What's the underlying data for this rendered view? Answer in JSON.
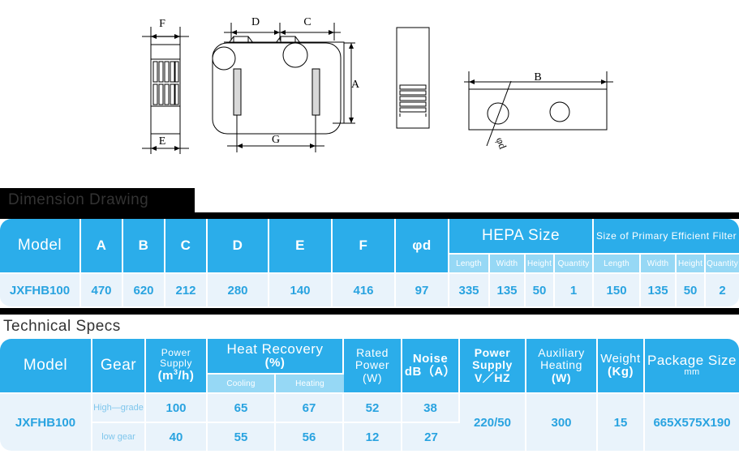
{
  "drawing": {
    "labels": {
      "f": "F",
      "e": "E",
      "d": "D",
      "c": "C",
      "g": "G",
      "a": "A",
      "b": "B",
      "phid": "φd"
    }
  },
  "sections": {
    "dimension_banner": "Dimension Drawing",
    "technical_banner": "Technical  Specs"
  },
  "dimension_table": {
    "headers": {
      "model": "Model",
      "a": "A",
      "b": "B",
      "c": "C",
      "d": "D",
      "e": "E",
      "f": "F",
      "phid": "φd",
      "hepa_size": "HEPA  Size",
      "primary_filter": "Size of Primary Efficient Filter"
    },
    "subheaders": {
      "hepa_length": "Length",
      "hepa_width": "Width",
      "hepa_height": "Height",
      "hepa_quantity": "Quantity",
      "pf_length": "Length",
      "pf_width": "Width",
      "pf_height": "Height",
      "pf_quantity": "Quantity"
    },
    "row": {
      "model": "JXFHB100",
      "a": "470",
      "b": "620",
      "c": "212",
      "d": "280",
      "e": "140",
      "f": "416",
      "phid": "97",
      "hepa_length": "335",
      "hepa_width": "135",
      "hepa_height": "50",
      "hepa_quantity": "1",
      "pf_length": "150",
      "pf_width": "135",
      "pf_height": "50",
      "pf_quantity": "2"
    }
  },
  "technical_table": {
    "headers": {
      "model": "Model",
      "gear": "Gear",
      "power_supply_line1": "Power",
      "power_supply_line2": "Supply",
      "power_supply_line3": "(m",
      "power_supply_sup": "3",
      "power_supply_line3b": "/h)",
      "heat_recovery_line1": "Heat  Recovery",
      "heat_recovery_line2": "(%)",
      "rated_power_line1": "Rated",
      "rated_power_line2": "Power",
      "rated_power_line3": "(W)",
      "noise_line1": "Noise",
      "noise_line2": "dB（A）",
      "power_supply_v_line1": "Power",
      "power_supply_v_line2": "Supply",
      "power_supply_v_line3": "V／HZ",
      "aux_heating_line1": "Auxiliary",
      "aux_heating_line2": "Heating",
      "aux_heating_line3": "(W)",
      "weight_line1": "Weight",
      "weight_line2": "(Kg)",
      "package_size_line1": "Package  Size",
      "package_size_line2": "mm"
    },
    "subheaders": {
      "cooling": "Cooling",
      "heating": "Heating"
    },
    "row": {
      "model": "JXFHB100",
      "gear_high": "High—grade",
      "gear_low": "low  gear",
      "airflow_high": "100",
      "airflow_low": "40",
      "cooling_high": "65",
      "cooling_low": "55",
      "heating_high": "67",
      "heating_low": "56",
      "rated_power_high": "52",
      "rated_power_low": "12",
      "noise_high": "38",
      "noise_low": "27",
      "power_supply_v": "220/50",
      "aux_heating": "300",
      "weight": "15",
      "package_size": "665X575X190"
    }
  },
  "colors": {
    "header_blue": "#2badea",
    "subheader_blue": "#96d8f5",
    "cell_bg": "#e9f3fb",
    "value_text": "#29a3e0"
  }
}
